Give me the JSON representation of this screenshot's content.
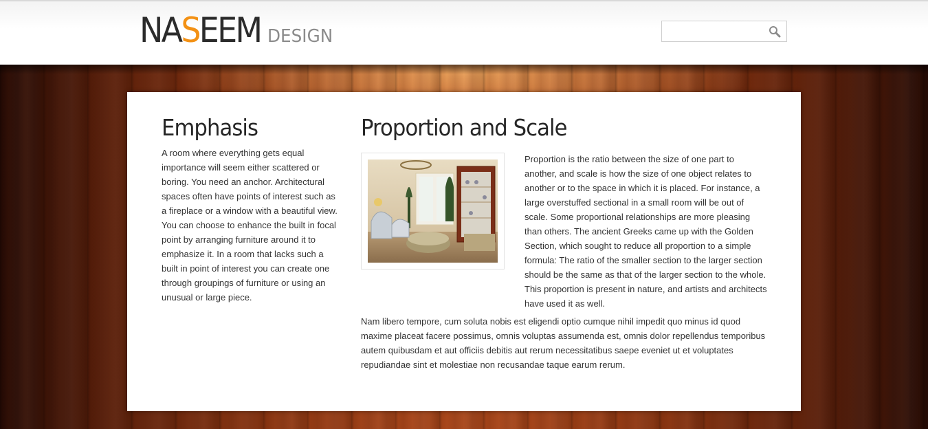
{
  "header": {
    "logo_main_prefix": "NA",
    "logo_main_accent": "S",
    "logo_main_suffix": "EEM",
    "logo_sub": "DESIGN",
    "search": {
      "placeholder": "",
      "value": "",
      "icon": "search-icon"
    }
  },
  "emphasis": {
    "heading": "Emphasis",
    "body": "A room where everything gets equal importance will seem either scattered or boring. You need an anchor. Architectural spaces often have points of interest such as a fireplace or a window with a beautiful view. You can choose to enhance the built in focal point by arranging furniture around it to emphasize it. In a room that lacks such a built in point of interest you can create one through groupings of furniture or using an unusual or large piece."
  },
  "proportion": {
    "heading": "Proportion and Scale",
    "image_alt": "Living room interior",
    "body": "Proportion is the ratio between the size of one part to another, and scale is how the size of one object relates to another or to the space in which it is placed. For instance, a large overstuffed sectional in a small room will be out of scale. Some proportional relationships are more pleasing than others. The ancient Greeks came up with the Golden Section, which sought to reduce all proportion to a simple formula: The ratio of the smaller section to the larger section should be the same as that of the larger section to the whole. This proportion is present in nature, and artists and architects have used it as well.",
    "extra": "Nam libero tempore, cum soluta nobis est eligendi optio cumque nihil impedit quo minus id quod maxime placeat facere possimus, omnis voluptas assumenda est, omnis dolor repellendus temporibus autem quibusdam et aut officiis debitis aut rerum necessitatibus saepe eveniet ut et voluptates repudiandae sint et molestiae non recusandae taque earum rerum."
  },
  "colors": {
    "logo_accent": "#f39114",
    "logo_text": "#2b2b2b",
    "logo_sub": "#8b8b8b",
    "wood": "#8a3511"
  }
}
